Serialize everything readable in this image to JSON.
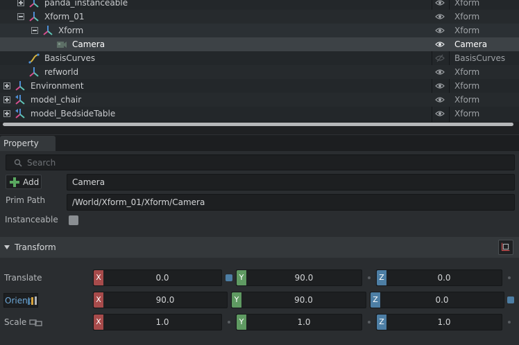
{
  "stage": {
    "rows": [
      {
        "name": "panda_instanceable",
        "type": "Xform"
      },
      {
        "name": "Xform_01",
        "type": "Xform"
      },
      {
        "name": "Xform",
        "type": "Xform"
      },
      {
        "name": "Camera",
        "type": "Camera"
      },
      {
        "name": "BasisCurves",
        "type": "BasisCurves"
      },
      {
        "name": "refworld",
        "type": "Xform"
      },
      {
        "name": "Environment",
        "type": "Xform"
      },
      {
        "name": "model_chair",
        "type": "Xform"
      },
      {
        "name": "model_BedsideTable",
        "type": "Xform"
      }
    ]
  },
  "property": {
    "tab_label": "Property",
    "search_placeholder": "Search",
    "add_label": "Add",
    "prim_name": "Camera",
    "prim_path_label": "Prim Path",
    "prim_path": "/World/Xform_01/Xform/Camera",
    "instanceable_label": "Instanceable",
    "instanceable": false
  },
  "transform": {
    "section_label": "Transform",
    "translate_label": "Translate",
    "orient_label": "Orient",
    "scale_label": "Scale",
    "axes": [
      "X",
      "Y",
      "Z"
    ],
    "translate": [
      "0.0",
      "90.0",
      "0.0"
    ],
    "orient": [
      "90.0",
      "90.0",
      "0.0"
    ],
    "scale": [
      "1.0",
      "1.0",
      "1.0"
    ]
  },
  "colors": {
    "axis_x": "#a74b4b",
    "axis_y": "#5f9a62",
    "axis_z": "#4d7ea4",
    "selected_row": "#3d4246"
  }
}
